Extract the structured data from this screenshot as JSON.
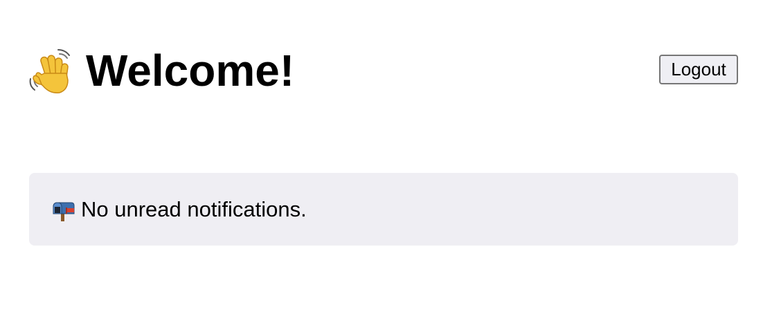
{
  "header": {
    "title_icon": "waving-hand-icon",
    "title": "Welcome!",
    "logout_label": "Logout"
  },
  "notice": {
    "icon": "mailbox-icon",
    "text": "No unread notifications."
  },
  "colors": {
    "background": "#ffffff",
    "notice_background": "#efeef3",
    "button_background": "#efeff4",
    "button_border": "#767676",
    "text": "#000000"
  }
}
